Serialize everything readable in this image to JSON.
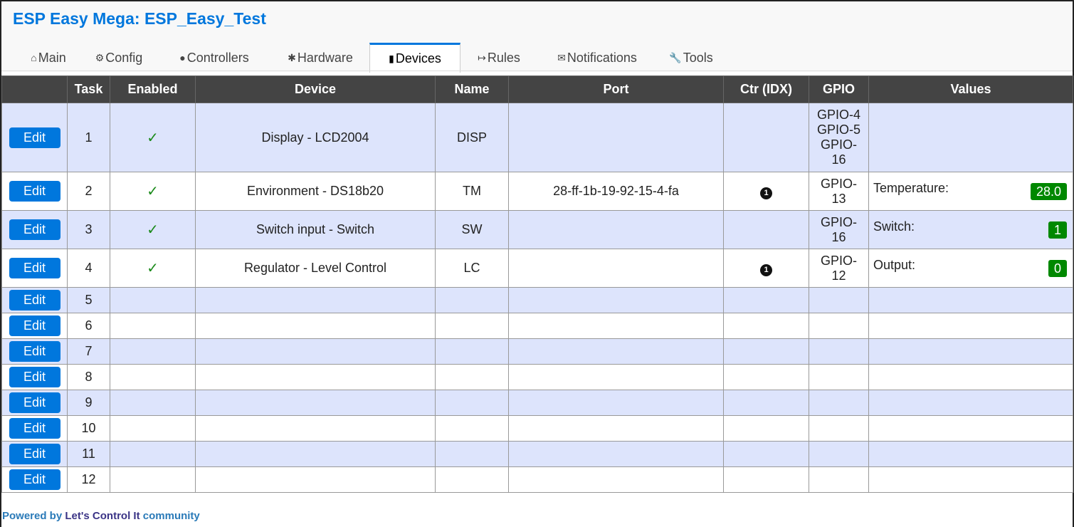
{
  "app": {
    "title": "ESP Easy Mega: ESP_Easy_Test"
  },
  "tabs": [
    {
      "icon": "⌂",
      "icon_name": "home-icon",
      "label": "Main"
    },
    {
      "icon": "⚙",
      "icon_name": "gear-icon",
      "label": "Config"
    },
    {
      "icon": "●",
      "icon_name": "speech-bubble-icon",
      "label": "Controllers"
    },
    {
      "icon": "✱",
      "icon_name": "pin-icon",
      "label": "Hardware"
    },
    {
      "icon": "▮",
      "icon_name": "plug-icon",
      "label": "Devices",
      "active": true
    },
    {
      "icon": "↦",
      "icon_name": "arrow-icon",
      "label": "Rules"
    },
    {
      "icon": "✉",
      "icon_name": "envelope-icon",
      "label": "Notifications"
    },
    {
      "icon": "🔧",
      "icon_name": "wrench-icon",
      "label": "Tools"
    }
  ],
  "table": {
    "headers": [
      "",
      "Task",
      "Enabled",
      "Device",
      "Name",
      "Port",
      "Ctr (IDX)",
      "GPIO",
      "Values"
    ],
    "edit_label": "Edit",
    "enabled_mark": "✓",
    "ctr_mark": "1",
    "rows": [
      {
        "task": "1",
        "enabled": true,
        "device": "Display - LCD2004",
        "name": "DISP",
        "port": "",
        "ctr": false,
        "gpio": [
          "GPIO-4",
          "GPIO-5",
          "GPIO-",
          "16"
        ],
        "value_label": "",
        "value": ""
      },
      {
        "task": "2",
        "enabled": true,
        "device": "Environment - DS18b20",
        "name": "TM",
        "port": "28-ff-1b-19-92-15-4-fa",
        "ctr": true,
        "gpio": [
          "GPIO-",
          "13"
        ],
        "value_label": "Temperature:",
        "value": "28.0"
      },
      {
        "task": "3",
        "enabled": true,
        "device": "Switch input - Switch",
        "name": "SW",
        "port": "",
        "ctr": false,
        "gpio": [
          "GPIO-",
          "16"
        ],
        "value_label": "Switch:",
        "value": "1"
      },
      {
        "task": "4",
        "enabled": true,
        "device": "Regulator - Level Control",
        "name": "LC",
        "port": "",
        "ctr": true,
        "gpio": [
          "GPIO-",
          "12"
        ],
        "value_label": "Output:",
        "value": "0"
      },
      {
        "task": "5"
      },
      {
        "task": "6"
      },
      {
        "task": "7"
      },
      {
        "task": "8"
      },
      {
        "task": "9"
      },
      {
        "task": "10"
      },
      {
        "task": "11"
      },
      {
        "task": "12"
      }
    ]
  },
  "footer": {
    "prefix": "Powered by ",
    "brand": "Let's Control It",
    "suffix": " community"
  },
  "colors": {
    "accent": "#0077DD",
    "header_bg": "#444444",
    "row_alt": "#DDE4FC",
    "value_badge": "#008800"
  }
}
